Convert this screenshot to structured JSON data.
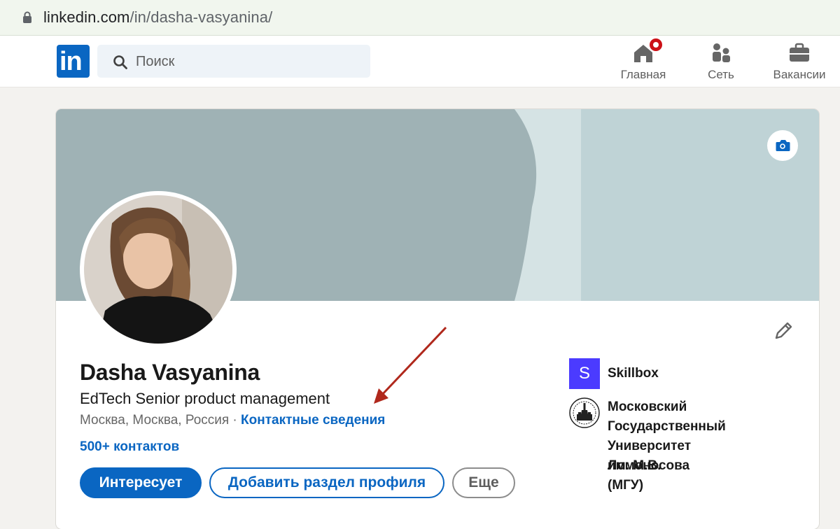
{
  "browser": {
    "url_domain": "linkedin.com",
    "url_path": "/in/dasha-vasyanina/"
  },
  "nav": {
    "logo_text": "in",
    "search_placeholder": "Поиск",
    "items": [
      {
        "label": "Главная",
        "icon": "home-icon",
        "has_badge": true
      },
      {
        "label": "Сеть",
        "icon": "network-icon"
      },
      {
        "label": "Вакансии",
        "icon": "jobs-icon"
      }
    ]
  },
  "profile": {
    "name": "Dasha Vasyanina",
    "headline": "EdTech Senior product management",
    "location": "Москва, Москва, Россия",
    "separator": " · ",
    "contact_info": "Контактные сведения",
    "connections": "500+ контактов",
    "buttons": {
      "open_to": "Интересует",
      "add_section": "Добавить раздел профиля",
      "more": "Еще"
    },
    "experience": [
      {
        "logo_letter": "S",
        "name": "Skillbox",
        "color": "#4b3bff"
      },
      {
        "name_lines": [
          "Московский",
          "Государственный",
          "Университет им. М.В.",
          "Ломоносова (МГУ)"
        ]
      }
    ]
  },
  "colors": {
    "brand": "#0a66c2",
    "cover_dark": "#9fb2b5",
    "cover_light": "#bfd3d6",
    "notification": "#cc1016",
    "annotation_arrow": "#b0281c"
  }
}
